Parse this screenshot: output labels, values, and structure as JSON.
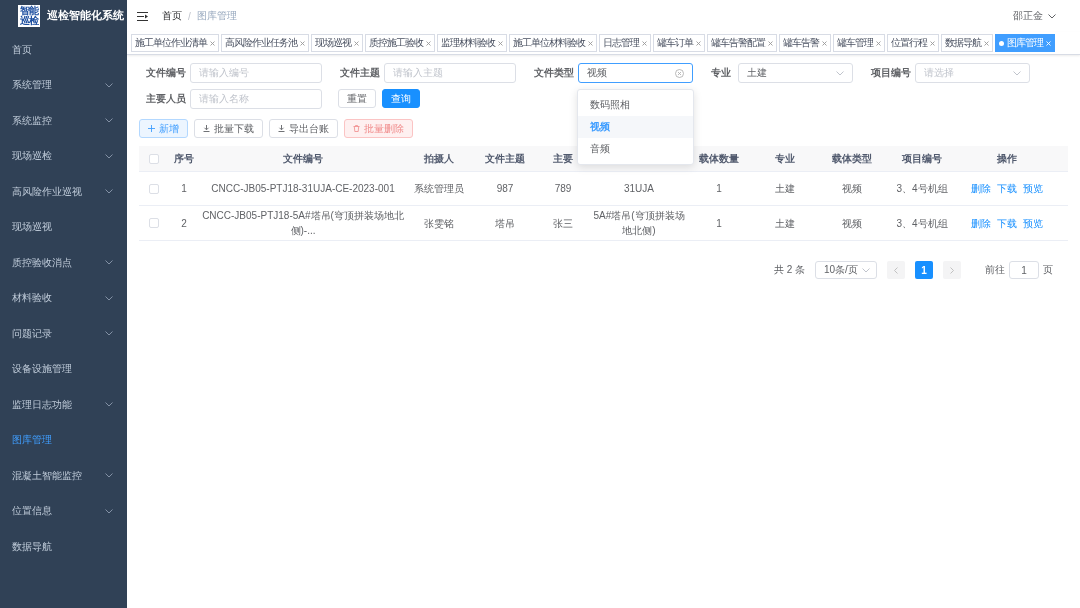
{
  "app": {
    "logo_text": "智能巡检",
    "title": "巡检智能化系统"
  },
  "sidebar": {
    "items": [
      {
        "label": "首页",
        "expandable": false,
        "selected": false
      },
      {
        "label": "系统管理",
        "expandable": true,
        "selected": false
      },
      {
        "label": "系统监控",
        "expandable": true,
        "selected": false
      },
      {
        "label": "现场巡检",
        "expandable": true,
        "selected": false
      },
      {
        "label": "高风险作业巡视",
        "expandable": true,
        "selected": false
      },
      {
        "label": "现场巡视",
        "expandable": false,
        "selected": false
      },
      {
        "label": "质控验收消点",
        "expandable": true,
        "selected": false
      },
      {
        "label": "材料验收",
        "expandable": true,
        "selected": false
      },
      {
        "label": "问题记录",
        "expandable": true,
        "selected": false
      },
      {
        "label": "设备设施管理",
        "expandable": false,
        "selected": false
      },
      {
        "label": "监理日志功能",
        "expandable": true,
        "selected": false
      },
      {
        "label": "图库管理",
        "expandable": false,
        "selected": true
      },
      {
        "label": "混凝土智能监控",
        "expandable": true,
        "selected": false
      },
      {
        "label": "位置信息",
        "expandable": true,
        "selected": false
      },
      {
        "label": "数据导航",
        "expandable": false,
        "selected": false
      }
    ]
  },
  "header": {
    "breadcrumb": [
      "首页",
      "图库管理"
    ],
    "breadcrumb_separator": "/",
    "user": "邵正金"
  },
  "tabs": [
    {
      "label": "施工单位作业清单",
      "selected": false
    },
    {
      "label": "高风险作业任务池",
      "selected": false
    },
    {
      "label": "现场巡视",
      "selected": false
    },
    {
      "label": "质控施工验收",
      "selected": false
    },
    {
      "label": "监理材料验收",
      "selected": false
    },
    {
      "label": "施工单位材料验收",
      "selected": false
    },
    {
      "label": "日志管理",
      "selected": false
    },
    {
      "label": "罐车订单",
      "selected": false
    },
    {
      "label": "罐车告警配置",
      "selected": false
    },
    {
      "label": "罐车告警",
      "selected": false
    },
    {
      "label": "罐车管理",
      "selected": false
    },
    {
      "label": "位置行程",
      "selected": false
    },
    {
      "label": "数据导航",
      "selected": false
    },
    {
      "label": "图库管理",
      "selected": true
    }
  ],
  "filters": [
    {
      "label": "文件编号",
      "kind": "input",
      "placeholder": "请输入编号"
    },
    {
      "label": "文件主题",
      "kind": "input",
      "placeholder": "请输入主题"
    },
    {
      "label": "文件类型",
      "kind": "select",
      "value": "视频",
      "focused": true,
      "clearable": true,
      "options": [
        {
          "label": "数码照相",
          "selected": false
        },
        {
          "label": "视频",
          "selected": true
        },
        {
          "label": "音频",
          "selected": false
        }
      ]
    },
    {
      "label": "专业",
      "kind": "select",
      "value": "土建"
    },
    {
      "label": "项目编号",
      "kind": "select",
      "placeholder": "请选择"
    },
    {
      "label": "主要人员",
      "kind": "input",
      "placeholder": "请输入名称"
    }
  ],
  "filter_buttons": [
    {
      "label": "重置",
      "kind": "plain"
    },
    {
      "label": "查询",
      "kind": "primary"
    }
  ],
  "toolbar": [
    {
      "label": "新增",
      "kind": "add"
    },
    {
      "label": "批量下载",
      "kind": "download"
    },
    {
      "label": "导出台账",
      "kind": "download"
    },
    {
      "label": "批量删除",
      "kind": "danger"
    }
  ],
  "table": {
    "all_checked": false,
    "columns": [
      {
        "label": "序号"
      },
      {
        "label": "文件编号"
      },
      {
        "label": "拍摄人"
      },
      {
        "label": "文件主题"
      },
      {
        "label": "主要"
      },
      {},
      {
        "label": "载体数量"
      },
      {
        "label": "专业"
      },
      {
        "label": "载体类型"
      },
      {
        "label": "项目编号"
      },
      {
        "label": "操作"
      }
    ],
    "rows": [
      {
        "checked": false,
        "cells": [
          "1",
          "CNCC-JB05-PTJ18-31UJA-CE-2023-001",
          "系统管理员",
          "987",
          "789",
          "31UJA",
          "1",
          "土建",
          "视频",
          "3、4号机组"
        ],
        "actions": [
          "删除",
          "下载",
          "预览"
        ]
      },
      {
        "checked": false,
        "cells": [
          "2",
          "CNCC-JB05-PTJ18-5A#塔吊(穹顶拼装场地北侧)-...",
          "张雯铭",
          "塔吊",
          "张三",
          "5A#塔吊(穹顶拼装场地北侧)",
          "1",
          "土建",
          "视频",
          "3、4号机组"
        ],
        "actions": [
          "删除",
          "下载",
          "预览"
        ]
      }
    ]
  },
  "pagination": {
    "total": "共 2 条",
    "page_size": "10条/页",
    "pages": [
      {
        "label": "1",
        "selected": true
      }
    ],
    "goto_label": "前往",
    "goto_value": "1",
    "goto_suffix": "页"
  }
}
